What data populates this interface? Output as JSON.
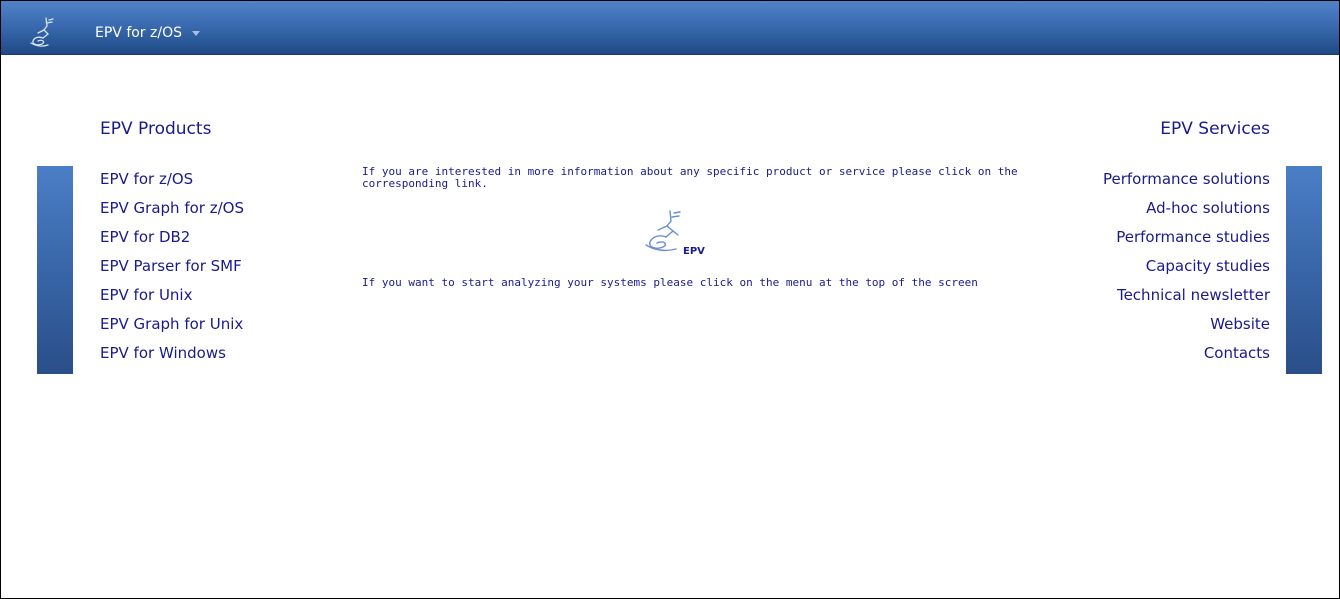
{
  "header": {
    "menu_label": "EPV for z/OS"
  },
  "products": {
    "title": "EPV Products",
    "items": [
      "EPV for z/OS",
      "EPV Graph for z/OS",
      "EPV for DB2",
      "EPV Parser for SMF",
      "EPV for Unix",
      "EPV Graph for Unix",
      "EPV for Windows"
    ]
  },
  "services": {
    "title": "EPV Services",
    "items": [
      "Performance solutions",
      "Ad-hoc solutions",
      "Performance studies",
      "Capacity studies",
      "Technical newsletter",
      "Website",
      "Contacts"
    ]
  },
  "center": {
    "info_text": "If you are interested in more information about any specific product or service please click on the corresponding link.",
    "logo_text": "EPV",
    "start_text": "If you want to start analyzing your systems please click on the menu at the top of the screen"
  },
  "icons": {
    "logo": "epv-figure-logo",
    "menu_caret": "chevron-down-icon"
  },
  "colors": {
    "header_top": "#4f83c7",
    "header_bottom": "#1f4a86",
    "text": "#1a1a8c"
  }
}
